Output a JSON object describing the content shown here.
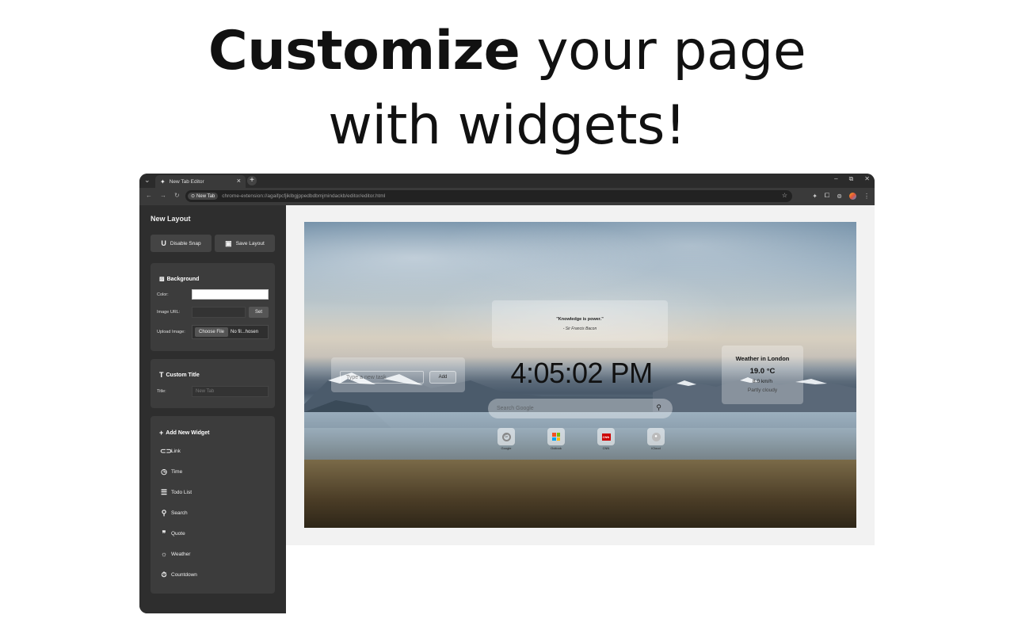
{
  "headline": {
    "bold": "Customize",
    "rest_line1": " your page",
    "line2": "with widgets!"
  },
  "browser": {
    "tab_title": "New Tab Editor",
    "chip_label": "New Tab",
    "url": "chrome-extension://agaifpcfjiklbgjppedbdbmjmindackb/editor/editor.html"
  },
  "sidebar": {
    "title": "New Layout",
    "disable_snap": "Disable Snap",
    "save_layout": "Save Layout",
    "background": {
      "heading": "Background",
      "color_label": "Color:",
      "image_url_label": "Image URL:",
      "set_label": "Set",
      "upload_label": "Upload Image:",
      "choose_file": "Choose File",
      "no_file": "No fil...hosen"
    },
    "custom_title": {
      "heading": "Custom Title",
      "title_label": "Title:",
      "title_placeholder": "New Tab"
    },
    "add_widget": {
      "heading": "Add New Widget",
      "items": [
        "Link",
        "Time",
        "Todo List",
        "Search",
        "Quote",
        "Weather",
        "Countdown"
      ]
    }
  },
  "preview": {
    "quote_text": "\"Knowledge is power.\"",
    "quote_author": "- Sir Francis Bacon",
    "todo_placeholder": "Type a new task",
    "todo_add": "Add",
    "clock": "4:05:02 PM",
    "weather_title": "Weather in London",
    "weather_temp": "19.0 °C",
    "weather_wind": "8.0 km/h",
    "weather_desc": "Partly cloudy",
    "search_placeholder": "Search Google",
    "shortcuts": [
      "Google",
      "Outlook",
      "CNN",
      "iCloud"
    ]
  }
}
